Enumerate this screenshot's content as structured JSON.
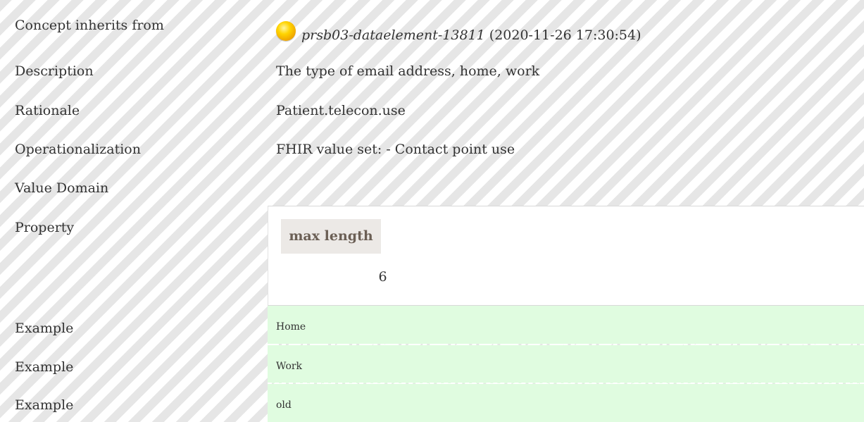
{
  "rows": {
    "inherits": {
      "label": "Concept inherits from",
      "ref_id": "prsb03-dataelement-13811",
      "ref_date": "(2020-11-26 17:30:54)",
      "status_icon": "yellow-orb-icon"
    },
    "description": {
      "label": "Description",
      "value": "The type of email address, home, work"
    },
    "rationale": {
      "label": "Rationale",
      "value": "Patient.telecon.use"
    },
    "operationalization": {
      "label": "Operationalization",
      "value": "FHIR value set: - Contact point use"
    },
    "value_domain": {
      "label": "Value Domain"
    },
    "property": {
      "label": "Property",
      "header": "max length",
      "value": "6"
    },
    "examples": [
      {
        "label": "Example",
        "value": "Home"
      },
      {
        "label": "Example",
        "value": "Work"
      },
      {
        "label": "Example",
        "value": "old"
      }
    ]
  },
  "colors": {
    "example_bg": "#e0fce0",
    "header_bg": "#ece9e6",
    "header_text": "#6b5f55",
    "stripe": "#e6e6e6",
    "orb": "#ffd400"
  }
}
